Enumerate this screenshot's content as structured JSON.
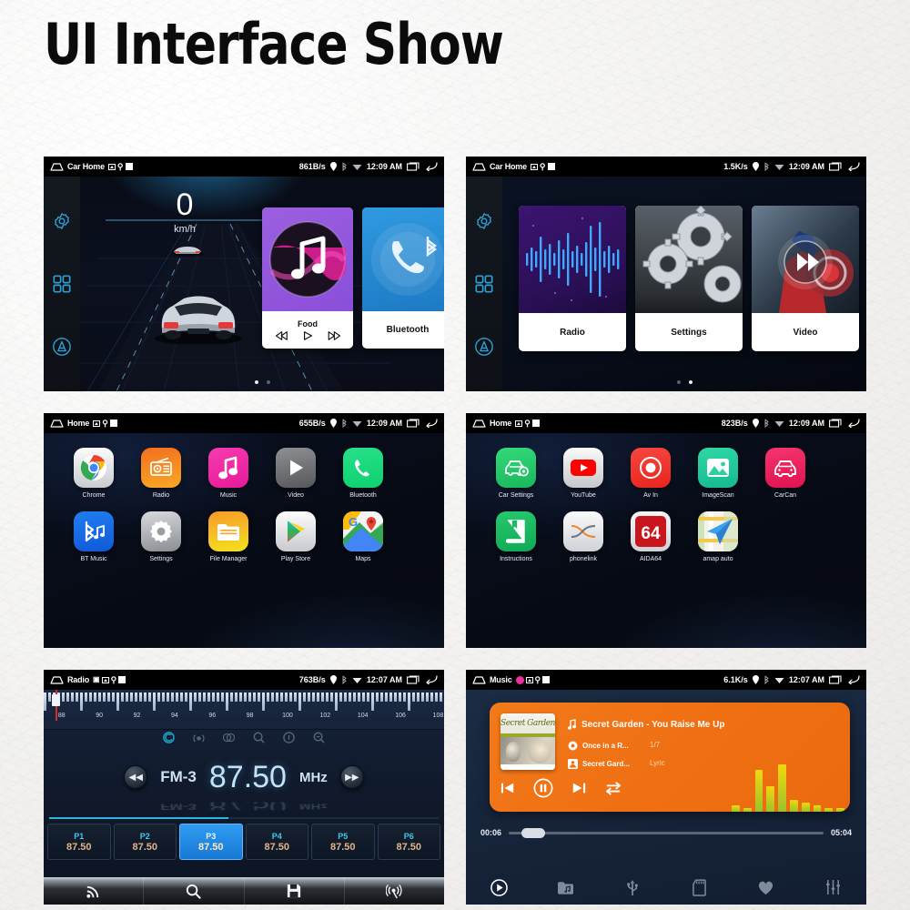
{
  "page": {
    "title": "UI Interface Show"
  },
  "screens": [
    {
      "id": "car-home-1",
      "status": {
        "title": "Car Home",
        "speed": "861B/s",
        "clock": "12:09 AM"
      },
      "speedometer": {
        "value": "0",
        "unit": "km/h"
      },
      "cards": [
        {
          "label": "Food",
          "kind": "music-card"
        },
        {
          "label": "Bluetooth",
          "kind": "bluetooth-card"
        }
      ],
      "page_dots": {
        "count": 2,
        "active": 1
      }
    },
    {
      "id": "car-home-2",
      "status": {
        "title": "Car Home",
        "speed": "1.5K/s",
        "clock": "12:09 AM"
      },
      "cards": [
        {
          "label": "Radio",
          "kind": "radio-card"
        },
        {
          "label": "Settings",
          "kind": "settings-card"
        },
        {
          "label": "Video",
          "kind": "video-card"
        }
      ],
      "page_dots": {
        "count": 2,
        "active": 2
      }
    },
    {
      "id": "app-drawer-1",
      "status": {
        "title": "Home",
        "speed": "655B/s",
        "clock": "12:09 AM"
      },
      "apps_row1": [
        {
          "label": "Chrome",
          "icon": "chrome-icon"
        },
        {
          "label": "Radio",
          "icon": "radio-icon"
        },
        {
          "label": "Music",
          "icon": "music-note-icon"
        },
        {
          "label": "Video",
          "icon": "play-triangle-icon"
        },
        {
          "label": "Bluetooth",
          "icon": "phone-handset-icon"
        }
      ],
      "apps_row2": [
        {
          "label": "BT Music",
          "icon": "bluetooth-music-icon"
        },
        {
          "label": "Settings",
          "icon": "gear-icon"
        },
        {
          "label": "File Manager",
          "icon": "folder-icon"
        },
        {
          "label": "Play Store",
          "icon": "play-store-icon"
        },
        {
          "label": "Maps",
          "icon": "google-maps-icon"
        }
      ]
    },
    {
      "id": "app-drawer-2",
      "status": {
        "title": "Home",
        "speed": "823B/s",
        "clock": "12:09 AM"
      },
      "apps_row1": [
        {
          "label": "Car Settings",
          "icon": "car-gear-icon"
        },
        {
          "label": "YouTube",
          "icon": "youtube-icon"
        },
        {
          "label": "Av In",
          "icon": "av-in-icon"
        },
        {
          "label": "ImageScan",
          "icon": "image-icon"
        },
        {
          "label": "CarCan",
          "icon": "car-front-icon"
        }
      ],
      "apps_row2": [
        {
          "label": "Instructions",
          "icon": "book-icon"
        },
        {
          "label": "phonelink",
          "icon": "phonelink-icon"
        },
        {
          "label": "AIDA64",
          "icon": "aida64-icon"
        },
        {
          "label": "amap auto",
          "icon": "amap-paperplane-icon"
        }
      ]
    },
    {
      "id": "radio",
      "status": {
        "title": "Radio",
        "speed": "763B/s",
        "clock": "12:07 AM"
      },
      "scale_labels": [
        "88",
        "90",
        "92",
        "94",
        "96",
        "98",
        "100",
        "102",
        "104",
        "106",
        "108"
      ],
      "band": "FM-3",
      "frequency": "87.50",
      "unit": "MHz",
      "presets": [
        {
          "name": "P1",
          "freq": "87.50",
          "active": false
        },
        {
          "name": "P2",
          "freq": "87.50",
          "active": false
        },
        {
          "name": "P3",
          "freq": "87.50",
          "active": true
        },
        {
          "name": "P4",
          "freq": "87.50",
          "active": false
        },
        {
          "name": "P5",
          "freq": "87.50",
          "active": false
        },
        {
          "name": "P6",
          "freq": "87.50",
          "active": false
        }
      ],
      "toolbar": [
        "rds-icon",
        "search-icon",
        "save-icon",
        "broadcast-icon"
      ]
    },
    {
      "id": "music",
      "status": {
        "title": "Music",
        "speed": "6.1K/s",
        "clock": "12:07 AM"
      },
      "album_art_text": "Secret Garden",
      "song": "Secret Garden - You Raise Me Up",
      "album": "Once in a R...",
      "artist": "Secret Gard...",
      "track_count": "1/7",
      "lyric_label": "Lyric",
      "time_elapsed": "00:06",
      "time_total": "05:04",
      "controls": [
        "prev-icon",
        "pause-icon",
        "next-icon",
        "repeat-icon"
      ],
      "nav": [
        "now-playing-icon",
        "music-folder-icon",
        "usb-icon",
        "sdcard-icon",
        "favorite-heart-icon",
        "equalizer-icon"
      ],
      "eq_bars": [
        10,
        5,
        62,
        38,
        70,
        18,
        14,
        9,
        5,
        6
      ]
    }
  ],
  "colors": {
    "accent_blue": "#2e9cf0",
    "sidebar_icon": "#2f9fd6",
    "orange_card": "#f27a1a",
    "preset_freq": "#e0b489",
    "preset_name": "#41c8e8"
  }
}
